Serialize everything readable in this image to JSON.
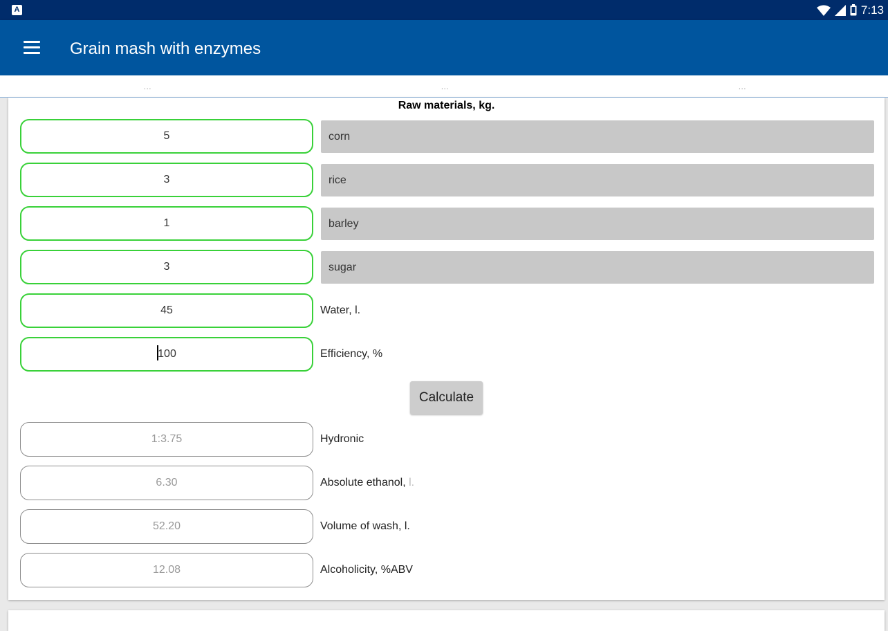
{
  "status": {
    "time": "7:13",
    "notif": "A"
  },
  "app": {
    "title": "Grain mash with enzymes"
  },
  "tabs": {
    "dots": "..."
  },
  "raw_materials": {
    "title": "Raw materials, kg.",
    "rows": [
      {
        "value": "5",
        "name": "corn"
      },
      {
        "value": "3",
        "name": "rice"
      },
      {
        "value": "1",
        "name": "barley"
      },
      {
        "value": "3",
        "name": "sugar"
      }
    ]
  },
  "water": {
    "value": "45",
    "label": "Water, l."
  },
  "efficiency": {
    "value": "100",
    "label": "Efficiency, %"
  },
  "calculate_label": "Calculate",
  "results": {
    "hydronic": {
      "value": "1:3.75",
      "label": "Hydronic"
    },
    "ethanol": {
      "value": "6.30",
      "label": "Absolute ethanol,",
      "unit": "l."
    },
    "wash": {
      "value": "52.20",
      "label": "Volume of wash, l."
    },
    "alcoholicity": {
      "value": "12.08",
      "label": "Alcoholicity, %ABV"
    }
  },
  "colors": {
    "status_bar": "#002c6b",
    "app_bar": "#00559e",
    "input_border": "#39d139"
  }
}
